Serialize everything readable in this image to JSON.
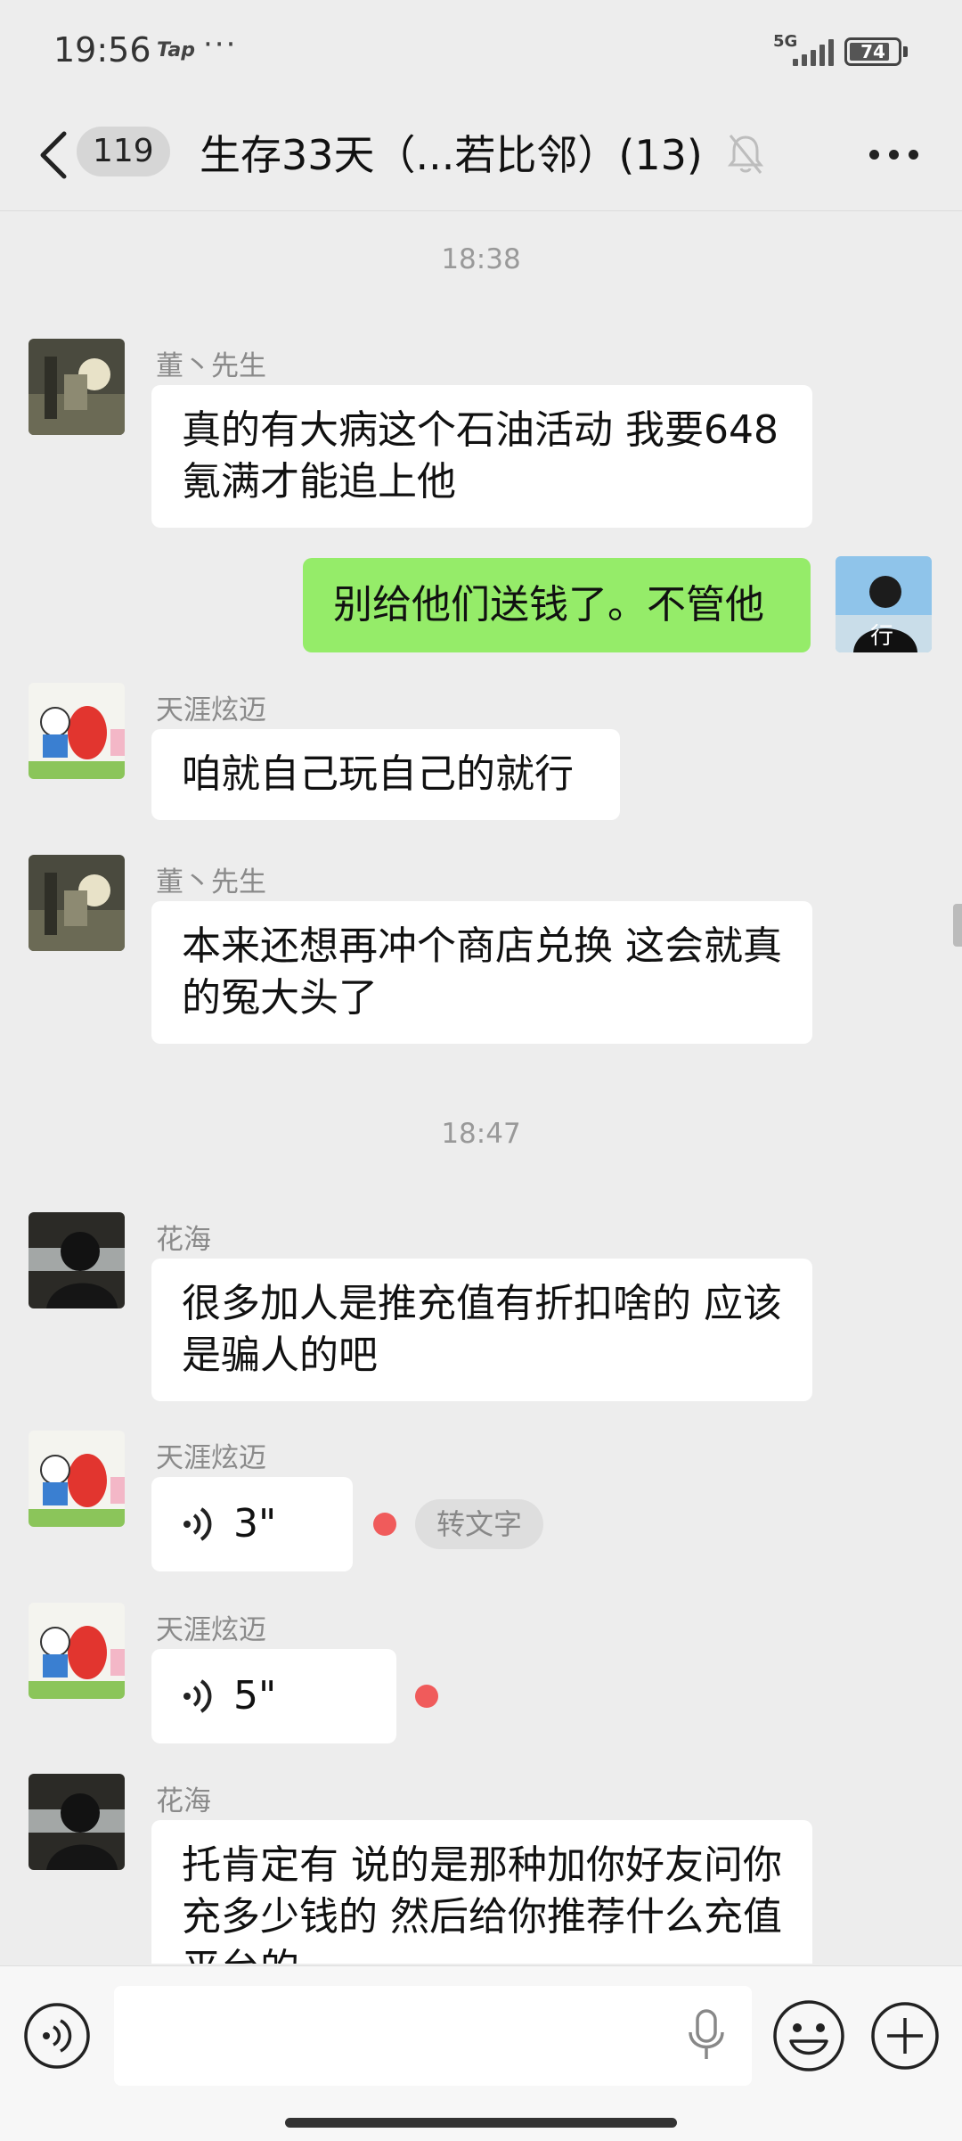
{
  "status_bar": {
    "time": "19:56",
    "app_tag": "Tap",
    "dots": "···",
    "network": "5G",
    "battery": "74"
  },
  "nav": {
    "back_icon": "chevron-left-icon",
    "unread_count": "119",
    "title": "生存33天（...若比邻）(13)",
    "mute_icon": "bell-off-icon",
    "more_icon": "more-dots-icon"
  },
  "messages": [
    {
      "type": "time",
      "text": "18:38"
    },
    {
      "type": "text",
      "sender": "董丶先生",
      "text": "真的有大病这个石油活动 我要648氪满才能追上他"
    },
    {
      "type": "text_self",
      "text": "别给他们送钱了。不管他"
    },
    {
      "type": "text",
      "sender": "天涯炫迈",
      "text": "咱就自己玩自己的就行"
    },
    {
      "type": "text",
      "sender": "董丶先生",
      "text": "本来还想再冲个商店兑换 这会就真的冤大头了"
    },
    {
      "type": "time",
      "text": "18:47"
    },
    {
      "type": "text",
      "sender": "花海",
      "text": "很多加人是推充值有折扣啥的  应该是骗人的吧"
    },
    {
      "type": "voice",
      "sender": "天涯炫迈",
      "duration": "3\"",
      "convert_label": "转文字"
    },
    {
      "type": "voice",
      "sender": "天涯炫迈",
      "duration": "5\""
    },
    {
      "type": "text",
      "sender": "花海",
      "text": "托肯定有  说的是那种加你好友问你充多少钱的 然后给你推荐什么充值平台的"
    }
  ],
  "input_bar": {
    "voice_icon": "voice-input-icon",
    "mic_icon": "microphone-icon",
    "emoji_icon": "emoji-icon",
    "plus_icon": "plus-icon"
  },
  "colors": {
    "background": "#ededed",
    "self_bubble": "#95ec69",
    "other_bubble": "#ffffff",
    "unread_dot": "#f05b5b"
  }
}
